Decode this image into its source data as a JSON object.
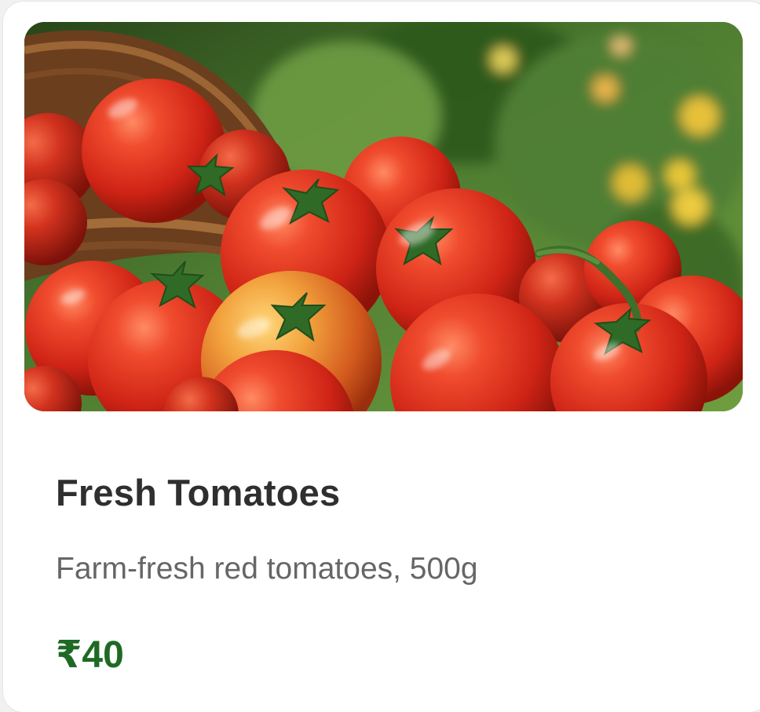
{
  "product": {
    "image_alt": "tomatoes-photo",
    "title": "Fresh Tomatoes",
    "description": "Farm-fresh red tomatoes, 500g",
    "price": "₹40"
  },
  "colors": {
    "page_background": "#f1f1f1",
    "card_background": "#ffffff",
    "title": "#2f2f2f",
    "description": "#666666",
    "price": "#1e6a24"
  }
}
